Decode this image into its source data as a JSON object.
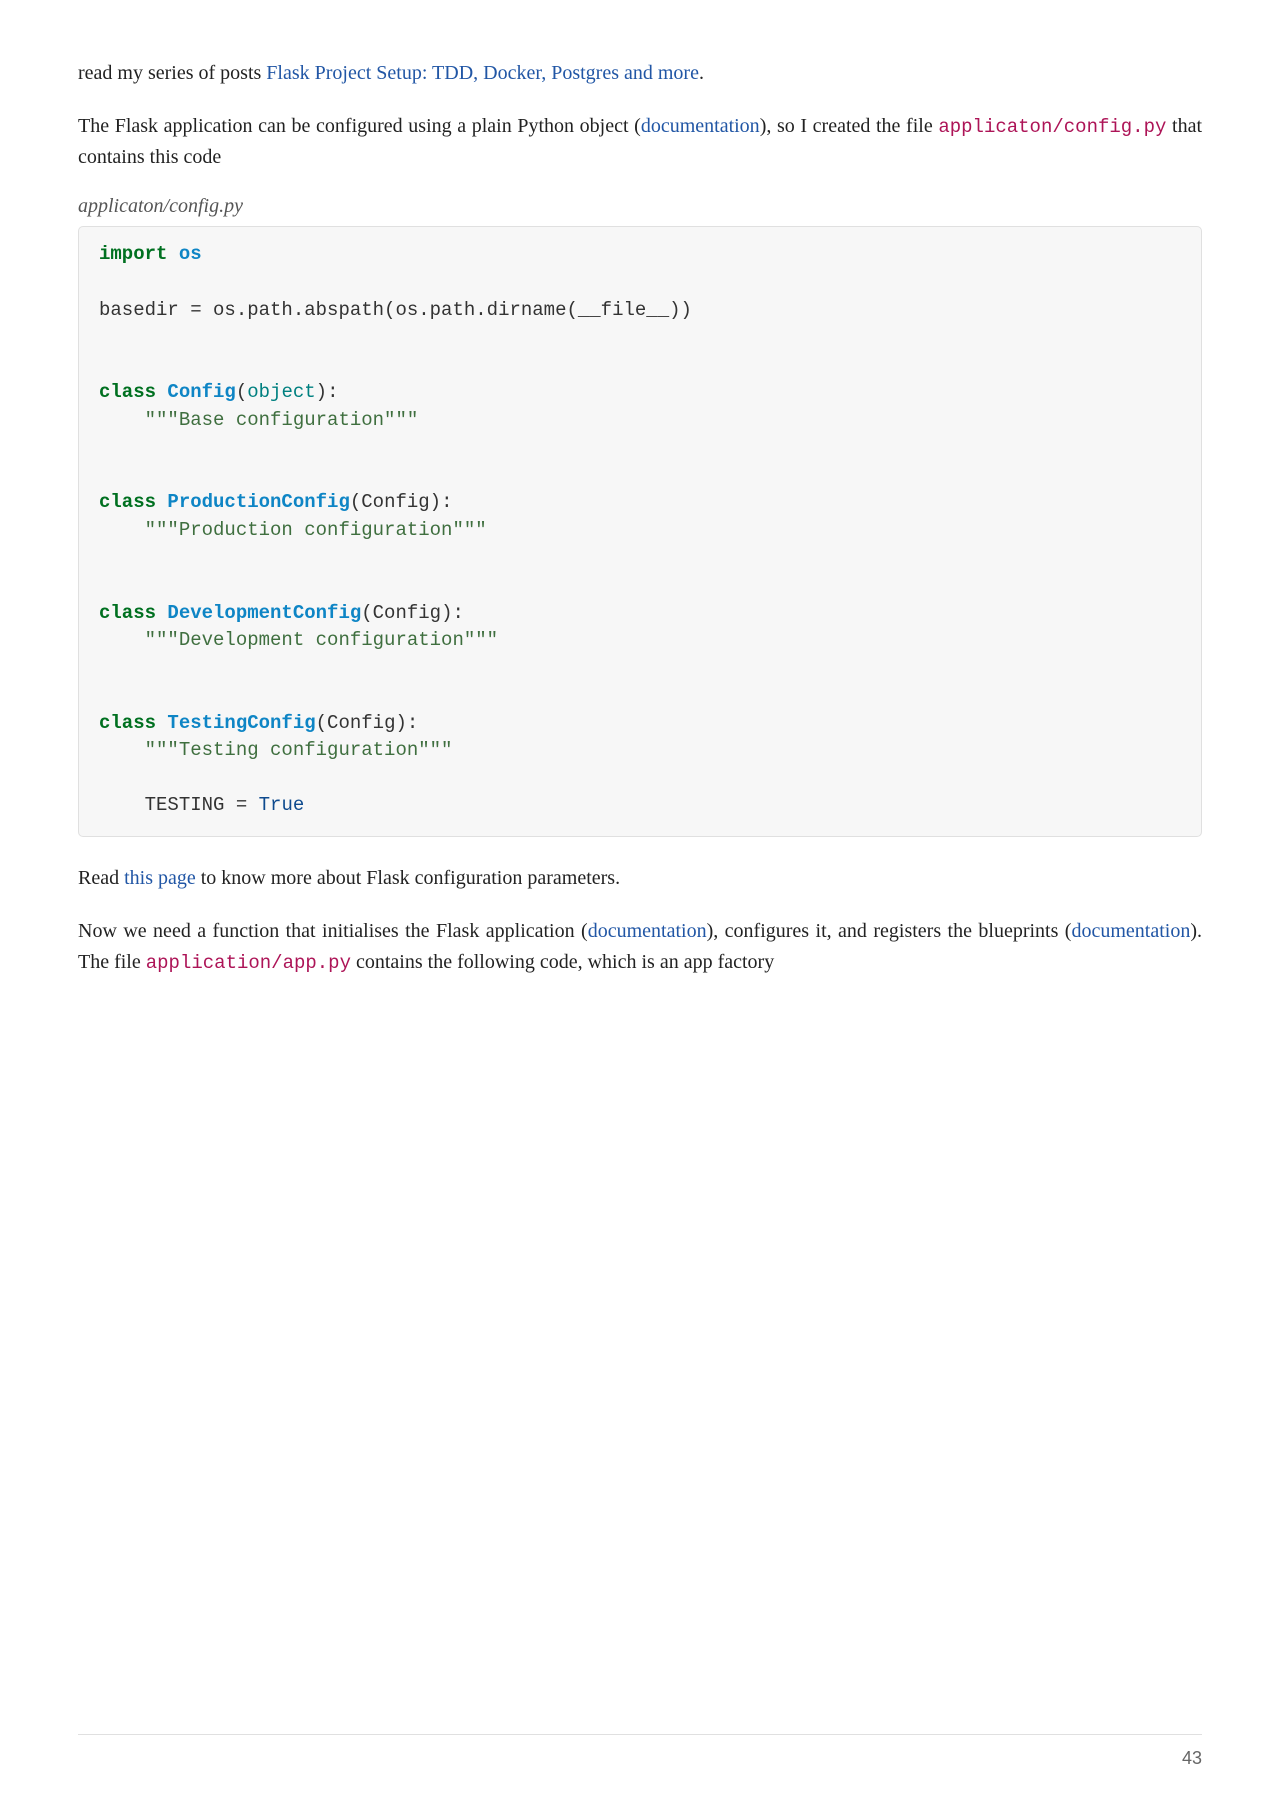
{
  "para1": {
    "pre": "read my series of posts ",
    "link": "Flask Project Setup: TDD, Docker, Postgres and more",
    "post": "."
  },
  "para2": {
    "t1": "The Flask application can be configured using a plain Python object (",
    "link1": "documentation",
    "t2": "), so I created the file ",
    "code": "applicaton/config.py",
    "t3": " that contains this code"
  },
  "caption1": "applicaton/config.py",
  "code1": {
    "l01_kw": "import",
    "l01_nm": " os",
    "l02": "",
    "l03": "basedir = os.path.abspath(os.path.dirname(__file__))",
    "l04": "",
    "l05": "",
    "l06_kw": "class",
    "l06_nm": " Config",
    "l06_p1": "(",
    "l06_bi": "object",
    "l06_p2": "):",
    "l07_ind": "    ",
    "l07_str": "\"\"\"Base configuration\"\"\"",
    "l08": "",
    "l09": "",
    "l10_kw": "class",
    "l10_nm": " ProductionConfig",
    "l10_rest": "(Config):",
    "l11_ind": "    ",
    "l11_str": "\"\"\"Production configuration\"\"\"",
    "l12": "",
    "l13": "",
    "l14_kw": "class",
    "l14_nm": " DevelopmentConfig",
    "l14_rest": "(Config):",
    "l15_ind": "    ",
    "l15_str": "\"\"\"Development configuration\"\"\"",
    "l16": "",
    "l17": "",
    "l18_kw": "class",
    "l18_nm": " TestingConfig",
    "l18_rest": "(Config):",
    "l19_ind": "    ",
    "l19_str": "\"\"\"Testing configuration\"\"\"",
    "l20": "",
    "l21_ind": "    ",
    "l21_var": "TESTING = ",
    "l21_const": "True"
  },
  "para3": {
    "t1": "Read ",
    "link": "this page",
    "t2": " to know more about Flask configuration parameters."
  },
  "para4": {
    "t1": "Now we need a function that initialises the Flask application (",
    "link1": "documentation",
    "t2": "), configures it, and registers the blueprints (",
    "link2": "documentation",
    "t3": "). The file ",
    "code": "application/app.py",
    "t4": " contains the following code, which is an app factory"
  },
  "pageNumber": "43"
}
